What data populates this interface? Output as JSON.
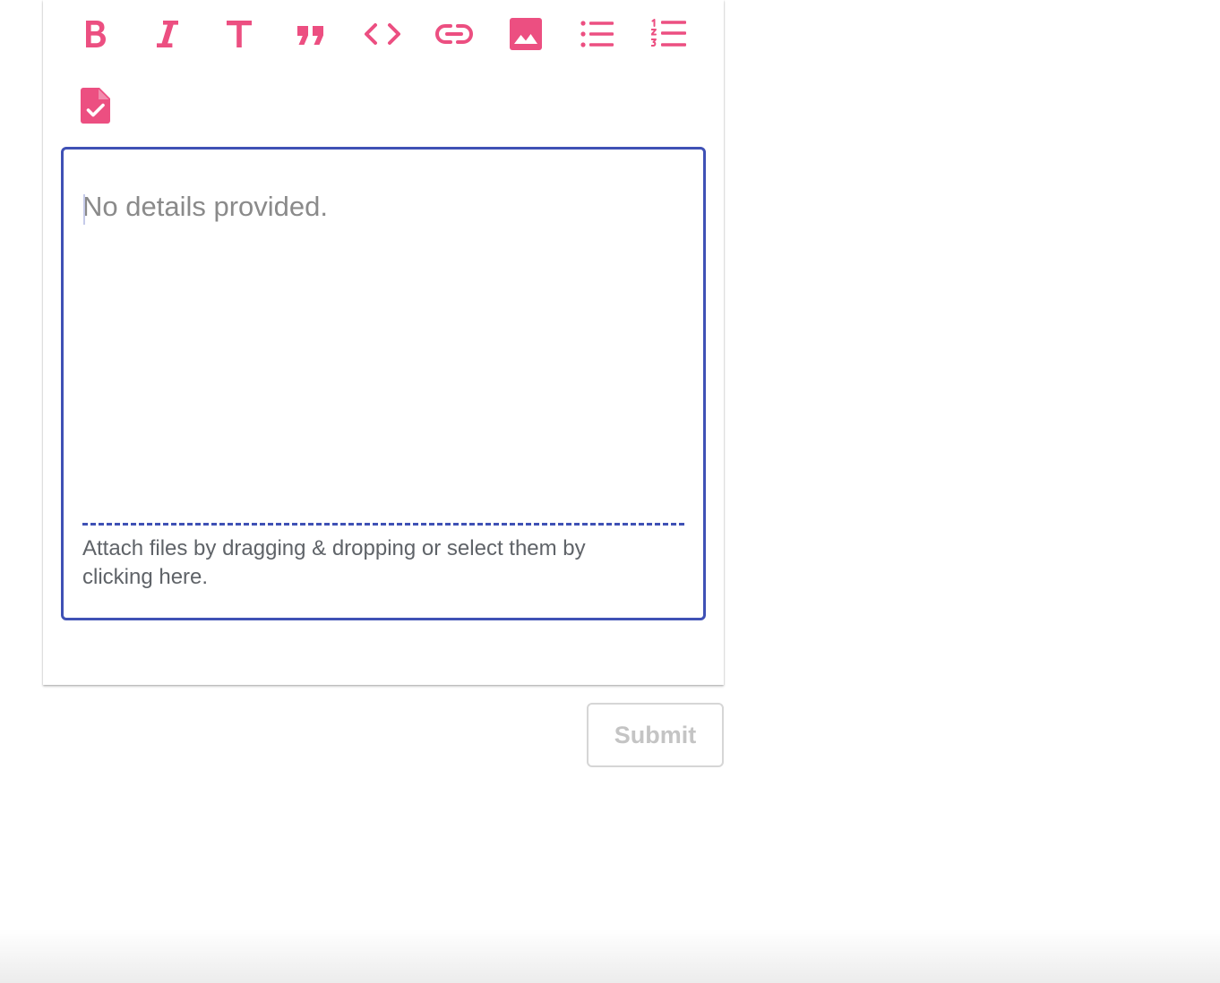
{
  "colors": {
    "toolbar_icon": "#ec4f81",
    "editor_border": "#3f51b5",
    "placeholder_text": "#8a8a8a",
    "dropzone_text": "#5f6368",
    "submit_border": "#d6d6d6",
    "submit_text": "#c4c4c4"
  },
  "toolbar": {
    "buttons": [
      {
        "icon": "bold-icon"
      },
      {
        "icon": "italic-icon"
      },
      {
        "icon": "heading-icon"
      },
      {
        "icon": "quote-icon"
      },
      {
        "icon": "code-icon"
      },
      {
        "icon": "link-icon"
      },
      {
        "icon": "image-icon"
      },
      {
        "icon": "bulleted-list-icon"
      },
      {
        "icon": "numbered-list-icon"
      },
      {
        "icon": "task-list-icon"
      }
    ]
  },
  "editor": {
    "value": "",
    "placeholder": "No details provided."
  },
  "dropzone": {
    "text": "Attach files by dragging & dropping or select them by clicking here."
  },
  "actions": {
    "submit_label": "Submit",
    "submit_disabled": true
  }
}
